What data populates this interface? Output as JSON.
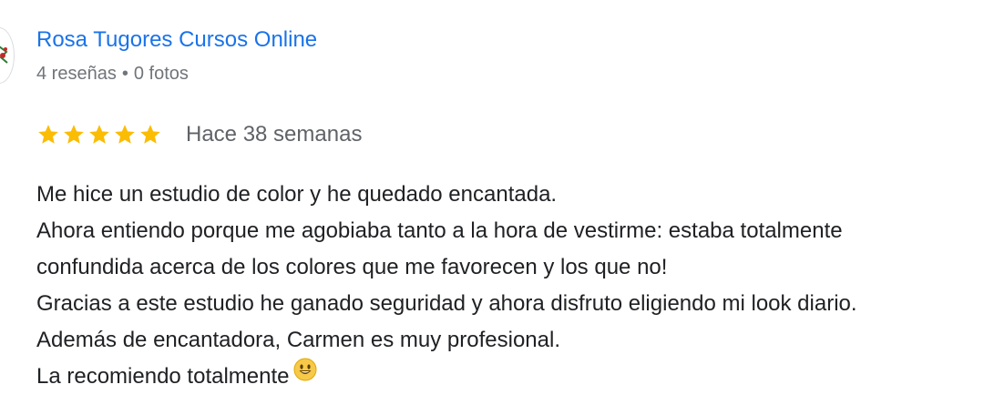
{
  "author": {
    "name": "Rosa Tugores Cursos Online",
    "reviews": "4 reseñas",
    "separator": "•",
    "photos": "0 fotos",
    "avatar_icon": "avatar-logo-icon"
  },
  "review": {
    "rating": 5,
    "max_rating": 5,
    "time": "Hace 38 semanas",
    "star_color": "#fbbc04",
    "lines": [
      "Me hice un estudio de color y he quedado encantada.",
      "Ahora entiendo porque me agobiaba tanto a la hora de vestirme: estaba totalmente",
      "confundida acerca de los colores que me favorecen y los que no!",
      "Gracias a este estudio he ganado seguridad y ahora disfruto eligiendo mi look diario.",
      "Además de encantadora, Carmen es muy profesional.",
      "La recomiendo totalmente"
    ],
    "trailing_emoji": "smiling-face-emoji"
  },
  "colors": {
    "link": "#1a73e8",
    "meta": "#70757a",
    "text": "#202124"
  }
}
